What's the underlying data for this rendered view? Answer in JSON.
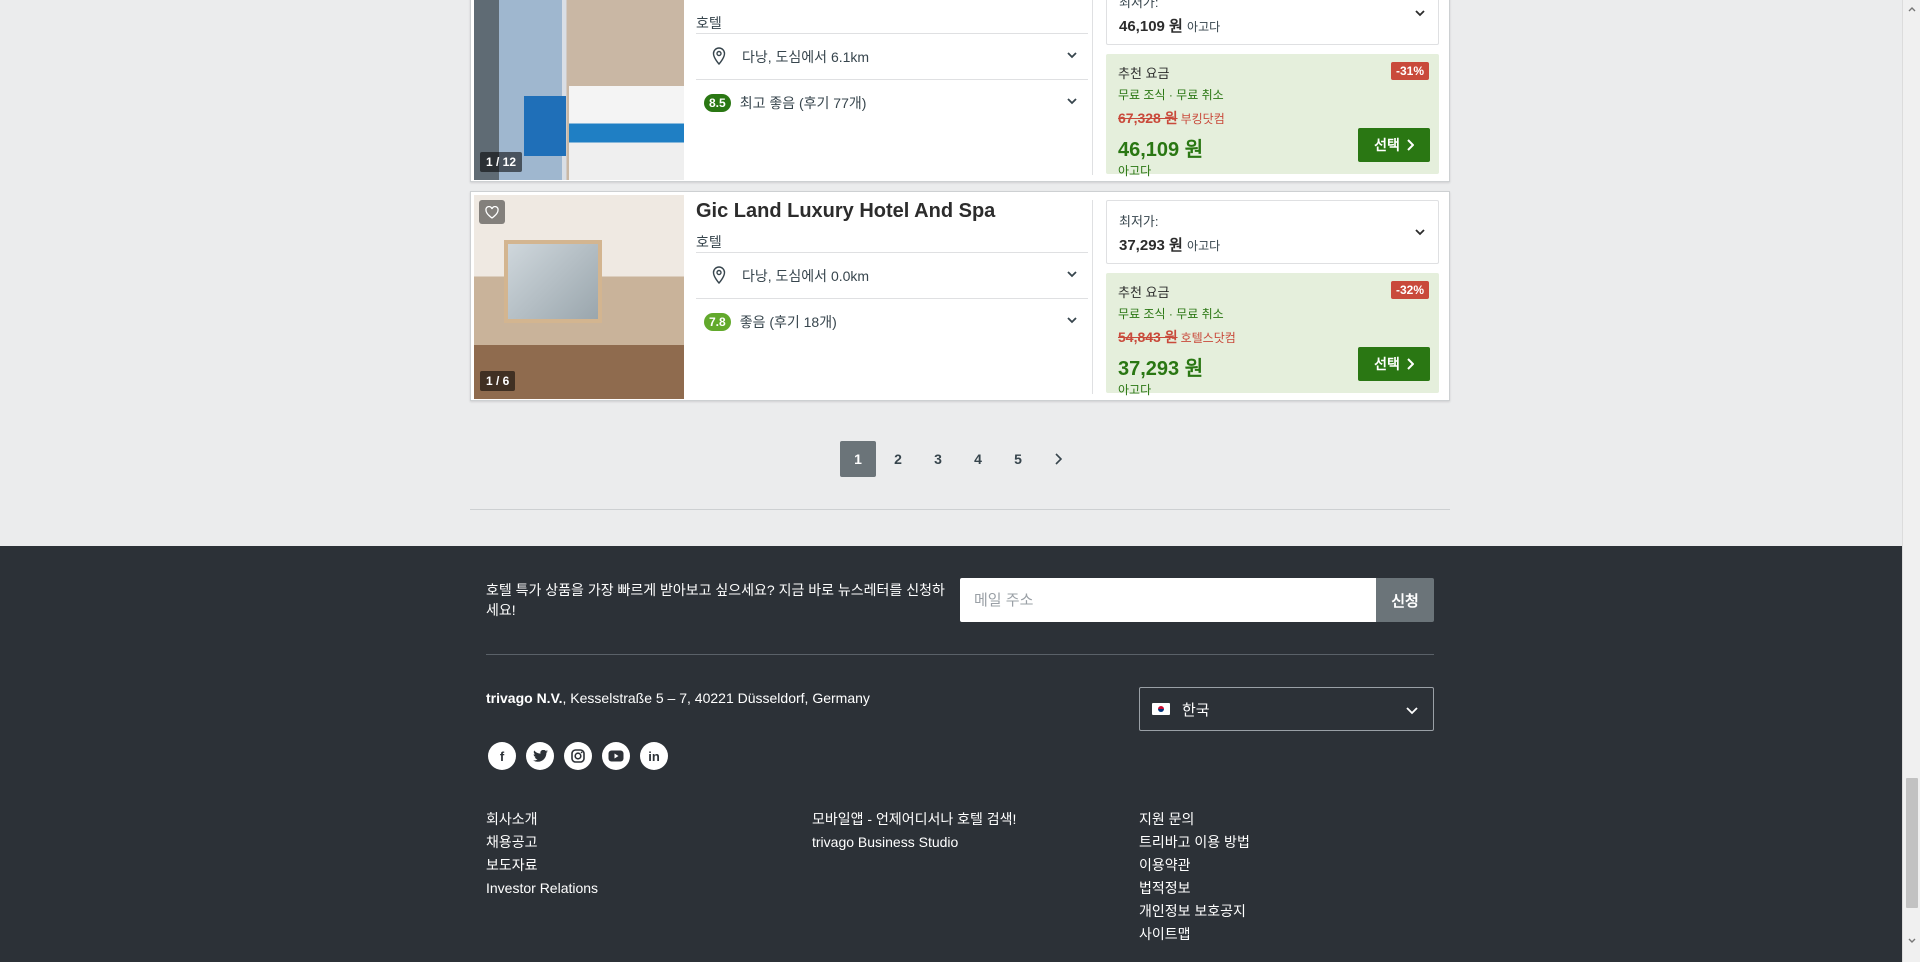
{
  "hotels": [
    {
      "name": "",
      "type": "호텔",
      "photo_counter": "1 / 12",
      "location": "다낭, 도심에서 6.1km",
      "rating_score": "8.5",
      "rating_text": "최고 좋음 (후기 77개)",
      "lowest_label": "최저가:",
      "lowest_price": "46,109 원",
      "lowest_site": "아고다",
      "deal_label": "추천 요금",
      "deal_perks": "무료 조식 · 무료 취소",
      "deal_discount": "-31%",
      "deal_old_price": "67,328 원",
      "deal_old_site": "부킹닷컴",
      "deal_price": "46,109 원",
      "deal_site": "아고다",
      "select_label": "선택"
    },
    {
      "name": "Gic Land Luxury Hotel And Spa",
      "type": "호텔",
      "photo_counter": "1 / 6",
      "location": "다낭, 도심에서 0.0km",
      "rating_score": "7.8",
      "rating_text": "좋음 (후기 18개)",
      "lowest_label": "최저가:",
      "lowest_price": "37,293 원",
      "lowest_site": "아고다",
      "deal_label": "추천 요금",
      "deal_perks": "무료 조식 · 무료 취소",
      "deal_discount": "-32%",
      "deal_old_price": "54,843 원",
      "deal_old_site": "호텔스닷컴",
      "deal_price": "37,293 원",
      "deal_site": "아고다",
      "select_label": "선택"
    }
  ],
  "pagination": {
    "pages": [
      "1",
      "2",
      "3",
      "4",
      "5"
    ],
    "current": "1",
    "next_icon": "chevron-right-icon"
  },
  "footer": {
    "newsletter_text": "호텔 특가 상품을 가장 빠르게 받아보고 싶으세요? 지금 바로 뉴스레터를 신청하세요!",
    "email_placeholder": "메일 주소",
    "subscribe_label": "신청",
    "company_name": "trivago N.V.",
    "company_address": ", Kesselstraße 5 – 7, 40221 Düsseldorf, Germany",
    "language": "한국",
    "socials": [
      "facebook-icon",
      "twitter-icon",
      "instagram-icon",
      "youtube-icon",
      "linkedin-icon"
    ],
    "links_col1": [
      "회사소개",
      "채용공고",
      "보도자료",
      "Investor Relations"
    ],
    "links_col2": [
      "모바일앱 - 언제어디서나 호텔 검색!",
      "trivago Business Studio"
    ],
    "links_col3": [
      "지원 문의",
      "트리바고 이용 방법",
      "이용약관",
      "법적정보",
      "개인정보 보호공지",
      "사이트맵"
    ]
  },
  "colors": {
    "deal_green": "#2a7713",
    "discount_red": "#c94a3b",
    "footer_bg": "#2c3137",
    "page_bg": "#ebeced"
  }
}
